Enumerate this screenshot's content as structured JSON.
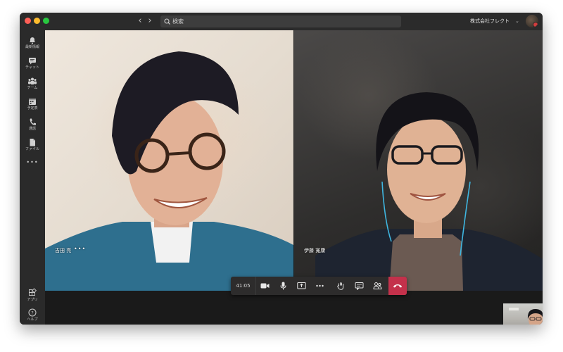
{
  "titlebar": {
    "search_placeholder": "検索",
    "org_name": "株式会社フレクト",
    "org_chevron": "⌄"
  },
  "sidebar": {
    "items": [
      {
        "label": "最新情報",
        "icon": "bell-icon"
      },
      {
        "label": "チャット",
        "icon": "chat-icon"
      },
      {
        "label": "チーム",
        "icon": "teams-icon"
      },
      {
        "label": "予定表",
        "icon": "calendar-icon"
      },
      {
        "label": "通話",
        "icon": "phone-icon"
      },
      {
        "label": "ファイル",
        "icon": "file-icon"
      },
      {
        "label": "•••",
        "icon": "more-icon"
      }
    ],
    "bottom_items": [
      {
        "label": "アプリ",
        "icon": "apps-icon"
      },
      {
        "label": "ヘルプ",
        "icon": "help-icon"
      }
    ]
  },
  "participants": [
    {
      "name": "吉田 亮",
      "more": "•••"
    },
    {
      "name": "伊藤 寛康"
    }
  ],
  "call_controls": {
    "timer": "41:05",
    "buttons": [
      "camera-icon",
      "microphone-icon",
      "share-screen-icon",
      "more-options-icon",
      "raise-hand-icon",
      "chat-icon",
      "participants-icon",
      "hang-up-icon"
    ]
  },
  "colors": {
    "hangup": "#c4314b",
    "window_bg": "#1f1f1f",
    "sidebar_bg": "#2a2a2a"
  }
}
